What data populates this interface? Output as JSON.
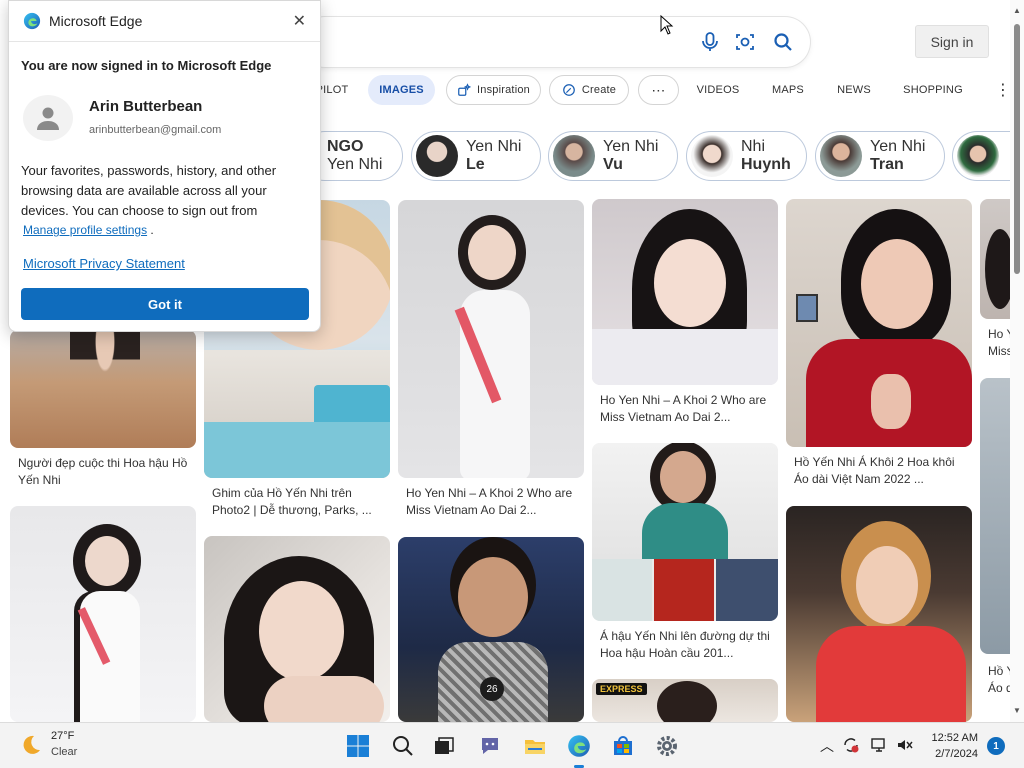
{
  "search": {
    "signin_label": "Sign in"
  },
  "tabs": [
    {
      "label": "PILOT",
      "kind": "plain"
    },
    {
      "label": "IMAGES",
      "kind": "active"
    },
    {
      "label": "Inspiration",
      "kind": "pill",
      "icon": "inspiration-icon"
    },
    {
      "label": "Create",
      "kind": "pill",
      "icon": "create-icon"
    },
    {
      "label": "⋯",
      "kind": "pill",
      "icon": "more-icon"
    },
    {
      "label": "VIDEOS",
      "kind": "plain"
    },
    {
      "label": "MAPS",
      "kind": "plain"
    },
    {
      "label": "NEWS",
      "kind": "plain"
    },
    {
      "label": "SHOPPING",
      "kind": "plain"
    }
  ],
  "chips": [
    {
      "line1": "NGO",
      "line2": "Yen Nhi",
      "bold": "line1"
    },
    {
      "line1": "Yen Nhi",
      "line2": "Le",
      "bold": "line2"
    },
    {
      "line1": "Yen Nhi",
      "line2": "Vu",
      "bold": "line2"
    },
    {
      "line1": "Nhi",
      "line2": "Huynh",
      "bold": "line2"
    },
    {
      "line1": "Yen Nhi",
      "line2": "Tran",
      "bold": "line2"
    },
    {
      "line1": "",
      "line2": "",
      "bold": "line2"
    }
  ],
  "captions": {
    "c1": "Người đẹp cuộc thi Hoa hậu Hồ Yến Nhi",
    "c2": "Ghim của Hồ Yến Nhi trên Photo2 | Dễ thương, Parks, ...",
    "c3": "Ho Yen Nhi – A Khoi 2 Who are Miss Vietnam Ao Dai 2...",
    "c4": "Ho Yen Nhi – A Khoi 2 Who are Miss Vietnam Ao Dai 2...",
    "c5": "Hồ Yến Nhi Á Khôi 2 Hoa khôi Áo dài Việt Nam 2022 ...",
    "c6": "Á hậu Yến Nhi lên đường dự thi Hoa hậu Hoàn cầu 201...",
    "c7a": "Ho Y",
    "c7b": "Miss",
    "c8a": "Hồ Y",
    "c8b": "Áo d",
    "express": "EXPRESS"
  },
  "flyout": {
    "title": "Microsoft Edge",
    "headline": "You are now signed in to Microsoft Edge",
    "name": "Arin Butterbean",
    "email": "arinbutterbean@gmail.com",
    "body": "Your favorites, passwords, history, and other browsing data are available across all your devices. You can choose to sign out from",
    "manage_link": "Manage profile settings",
    "privacy_link": "Microsoft Privacy Statement",
    "button": "Got it"
  },
  "taskbar": {
    "temp": "27°F",
    "condition": "Clear",
    "time": "12:52 AM",
    "date": "2/7/2024",
    "notifications": "1"
  },
  "colors": {
    "accent": "#0f6cbd",
    "active_tab_bg": "#e4ebfb"
  }
}
